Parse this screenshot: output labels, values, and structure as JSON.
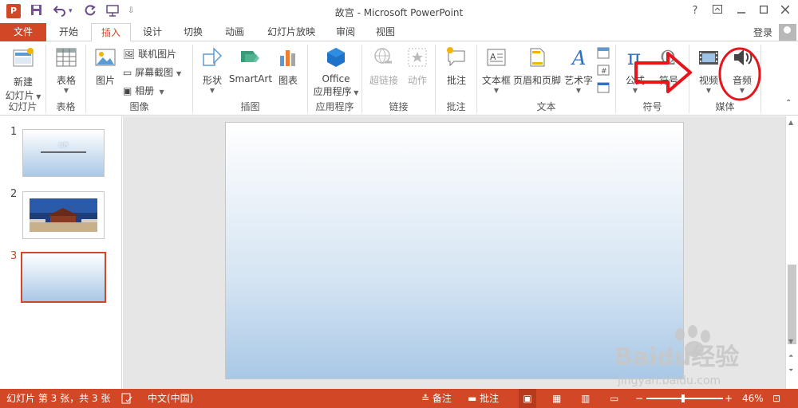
{
  "window": {
    "title": "故宫 - Microsoft PowerPoint",
    "app_logo": "P",
    "help": "?",
    "login": "登录"
  },
  "tabs": [
    {
      "label": "文件"
    },
    {
      "label": "开始"
    },
    {
      "label": "插入"
    },
    {
      "label": "设计"
    },
    {
      "label": "切换"
    },
    {
      "label": "动画"
    },
    {
      "label": "幻灯片放映"
    },
    {
      "label": "审阅"
    },
    {
      "label": "视图"
    }
  ],
  "ribbon": {
    "slides_group": {
      "label": "幻灯片",
      "new_slide_line1": "新建",
      "new_slide_line2": "幻灯片"
    },
    "tables_group": {
      "label": "表格",
      "table": "表格"
    },
    "images_group": {
      "label": "图像",
      "picture": "图片",
      "online_pictures": "联机图片",
      "screenshot": "屏幕截图",
      "album": "相册"
    },
    "illustrations_group": {
      "label": "插图",
      "shapes": "形状",
      "smartart": "SmartArt",
      "chart": "图表"
    },
    "apps_group": {
      "label": "应用程序",
      "office_line1": "Office",
      "office_line2": "应用程序"
    },
    "links_group": {
      "label": "链接",
      "hyperlink": "超链接",
      "action": "动作"
    },
    "comments_group": {
      "label": "批注",
      "comment": "批注"
    },
    "text_group": {
      "label": "文本",
      "textbox": "文本框",
      "header_footer": "页眉和页脚",
      "wordart": "艺术字"
    },
    "symbols_group": {
      "label": "符号",
      "equation": "公式",
      "symbol": "符号"
    },
    "media_group": {
      "label": "媒体",
      "video": "视频",
      "audio": "音频"
    }
  },
  "slides": [
    {
      "number": "1",
      "title": "故宫"
    },
    {
      "number": "2"
    },
    {
      "number": "3"
    }
  ],
  "status": {
    "slide_info": "幻灯片 第 3 张，共 3 张",
    "language": "中文(中国)",
    "notes": "备注",
    "comments": "批注",
    "zoom": "46%"
  },
  "watermark": {
    "brand": "Baidu经验",
    "url": "jingyan.baidu.com"
  },
  "colors": {
    "accent": "#d24726",
    "annotation": "#e8141b"
  }
}
